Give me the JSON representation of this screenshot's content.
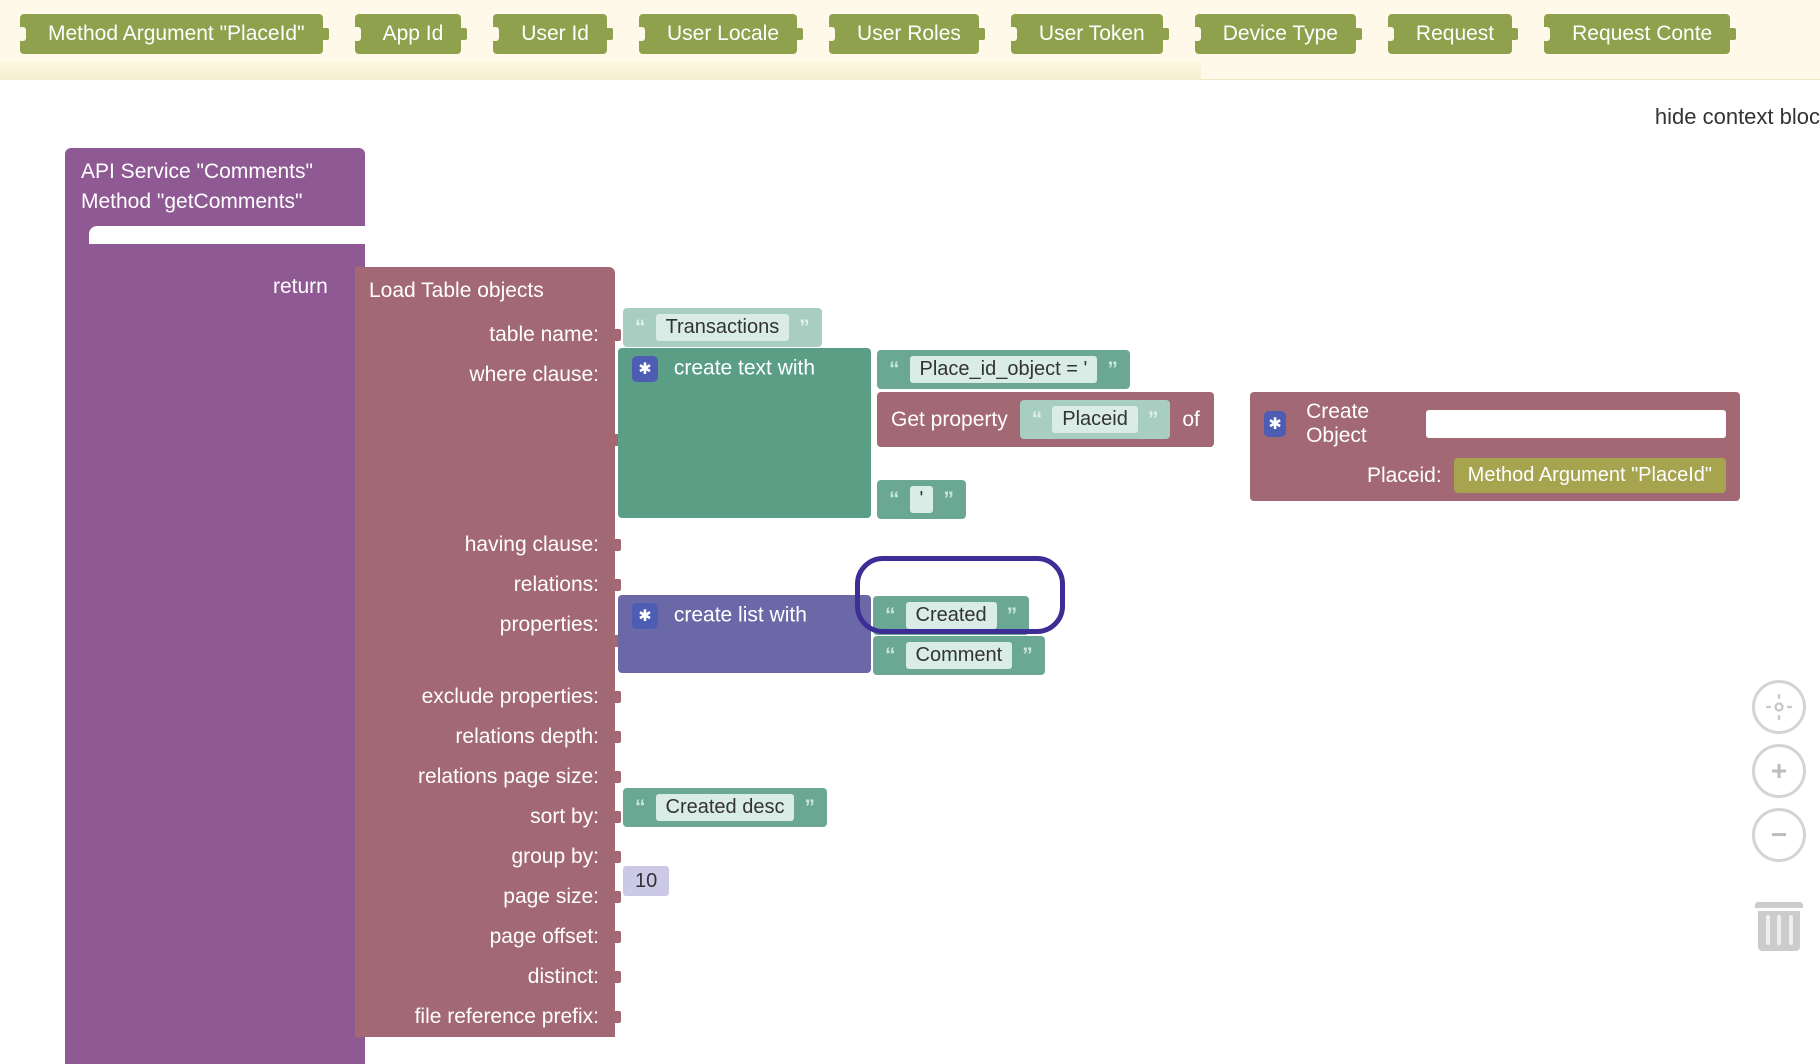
{
  "context_blocks": [
    "Method Argument \"PlaceId\"",
    "App Id",
    "User Id",
    "User Locale",
    "User Roles",
    "User Token",
    "Device Type",
    "Request",
    "Request Conte"
  ],
  "hide_context_label": "hide context bloc",
  "api": {
    "line1": "API Service \"Comments\"",
    "line2": "Method \"getComments\"",
    "return_label": "return"
  },
  "load": {
    "title": "Load Table objects",
    "rows": {
      "table_name": "table name:",
      "where_clause": "where clause:",
      "having_clause": "having clause:",
      "relations": "relations:",
      "properties": "properties:",
      "exclude_properties": "exclude properties:",
      "relations_depth": "relations depth:",
      "relations_page_size": "relations page size:",
      "sort_by": "sort by:",
      "group_by": "group by:",
      "page_size": "page size:",
      "page_offset": "page offset:",
      "distinct": "distinct:",
      "file_reference_prefix": "file reference prefix:"
    }
  },
  "values": {
    "table_name": "Transactions",
    "where_text1": "Place_id_object = '",
    "where_text3": "'",
    "create_text_with": "create text with",
    "get_property": "Get property",
    "of": "of",
    "placeid_pill": "Placeid",
    "create_object": "Create Object",
    "placeid_label": "Placeid:",
    "method_arg_placeid": "Method Argument \"PlaceId\"",
    "create_list_with": "create list with",
    "list_item1": "Created",
    "list_item2": "Comment",
    "sort_by_val": "Created desc",
    "page_size_val": "10"
  }
}
